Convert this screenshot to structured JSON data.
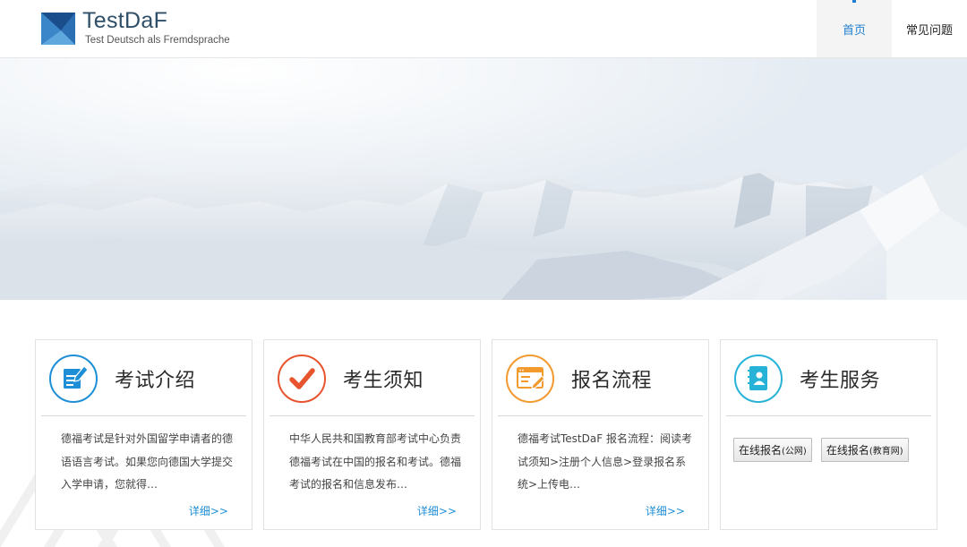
{
  "header": {
    "logo_title": "TestDaF",
    "logo_subtitle": "Test Deutsch als Fremdsprache",
    "nav": [
      {
        "label": "首页",
        "active": true
      },
      {
        "label": "常见问题",
        "active": false
      }
    ]
  },
  "cards": [
    {
      "title": "考试介绍",
      "icon": "document-edit-icon",
      "color": "#1e8fd6",
      "desc": "德福考试是针对外国留学申请者的德语语言考试。如果您向德国大学提交入学申请，您就得…",
      "more": "详细>>"
    },
    {
      "title": "考生须知",
      "icon": "checkmark-icon",
      "color": "#e8542e",
      "desc": "中华人民共和国教育部考试中心负责德福考试在中国的报名和考试。德福考试的报名和信息发布…",
      "more": "详细>>"
    },
    {
      "title": "报名流程",
      "icon": "registration-form-icon",
      "color": "#f29a2e",
      "desc": "德福考试TestDaF 报名流程：阅读考试须知>注册个人信息>登录报名系统>上传电…",
      "more": "详细>>"
    },
    {
      "title": "考生服务",
      "icon": "contact-book-icon",
      "color": "#27b2d8",
      "buttons": [
        {
          "main": "在线报名",
          "small": "(公网)"
        },
        {
          "main": "在线报名",
          "small": "(教育网)"
        }
      ]
    }
  ]
}
